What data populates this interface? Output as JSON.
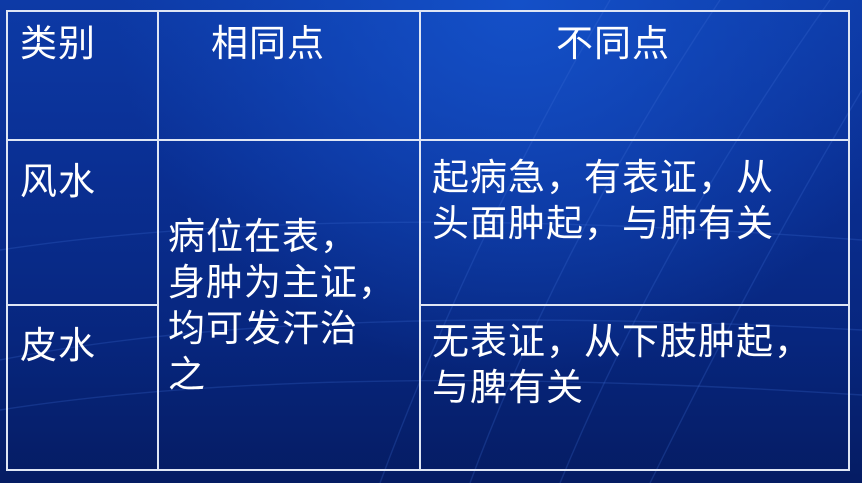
{
  "table": {
    "headers": [
      "类别",
      "相同点",
      "不同点"
    ],
    "rows": [
      {
        "category": "风水",
        "difference": [
          "起病急，有表证，从",
          "头面肿起，与肺有关"
        ]
      },
      {
        "category": "皮水",
        "difference": [
          "无表证，从下肢肿起，",
          "与脾有关"
        ]
      }
    ],
    "common": [
      "病位在表，",
      "身肿为主证，",
      "均可发汗治",
      "之"
    ]
  },
  "colors": {
    "background": "#0b2f8e",
    "grid": "#dfe6f5",
    "text": "#ffffff"
  }
}
